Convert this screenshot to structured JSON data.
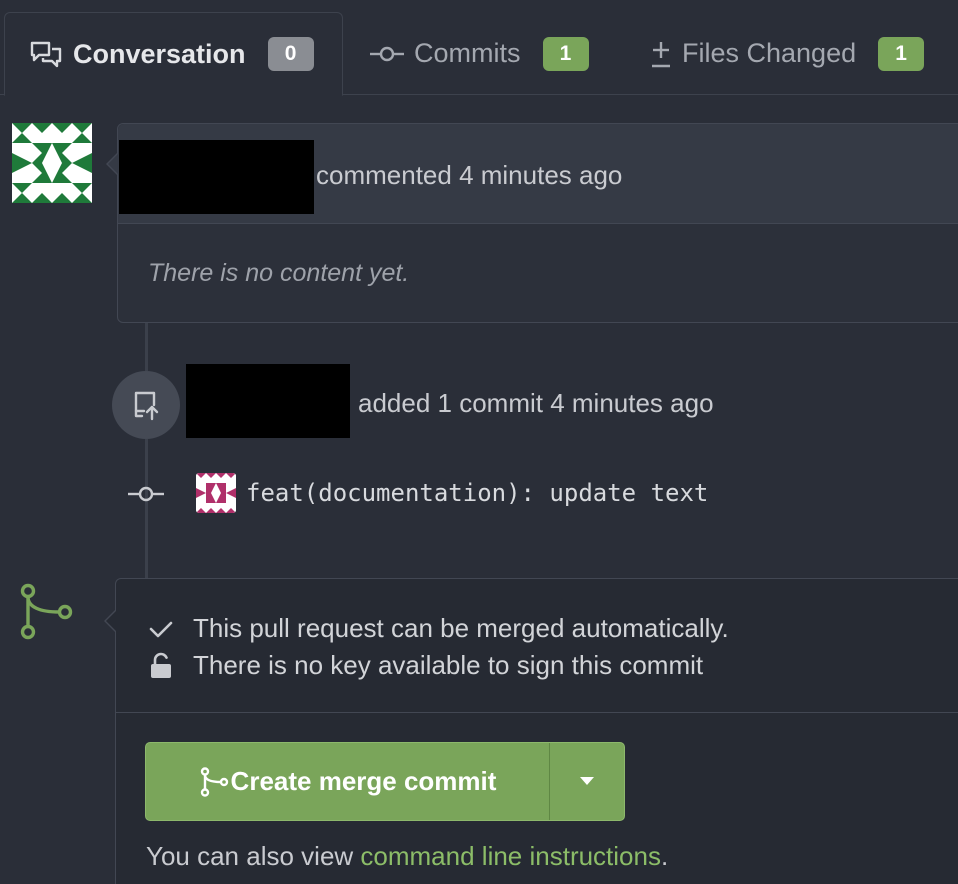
{
  "tabs": [
    {
      "label": "Conversation",
      "count": "0"
    },
    {
      "label": "Commits",
      "count": "1"
    },
    {
      "label": "Files Changed",
      "count": "1"
    }
  ],
  "comment": {
    "meta": "commented 4 minutes ago",
    "body": "There is no content yet."
  },
  "event": {
    "text": "added 1 commit 4 minutes ago",
    "commit_message": "feat(documentation): update text"
  },
  "merge": {
    "status_mergeable": "This pull request can be merged automatically.",
    "status_key": "There is no key available to sign this commit",
    "button_label": "Create merge commit",
    "help_prefix": "You can also view ",
    "help_link": "command line instructions",
    "help_suffix": "."
  },
  "colors": {
    "background": "#2a2e38",
    "accent_green": "#7aa55a",
    "link_green": "#8cbd68",
    "badge_grey": "#8a8d93"
  },
  "icons": {
    "conversation": "comments-icon",
    "commits": "commit-icon",
    "files": "plus-minus-icon",
    "event": "repo-push-icon",
    "merge": "git-merge-icon",
    "check": "check-icon",
    "lock": "unlock-icon",
    "dropdown": "caret-down-icon"
  }
}
